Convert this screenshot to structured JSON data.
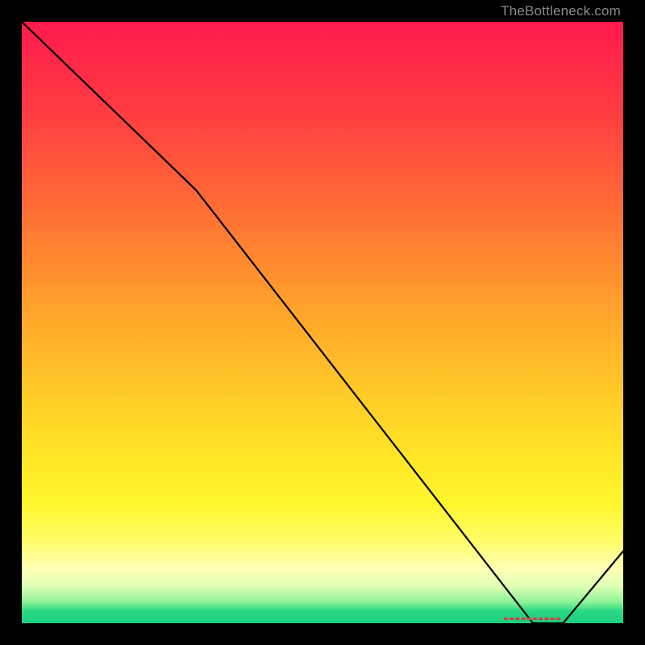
{
  "attribution": "TheBottleneck.com",
  "chart_data": {
    "type": "line",
    "x": [
      0,
      29,
      85,
      90,
      100
    ],
    "values": [
      100,
      72,
      0,
      0,
      12
    ],
    "title": "",
    "xlabel": "",
    "ylabel": "",
    "xlim": [
      0,
      100
    ],
    "ylim": [
      0,
      100
    ],
    "markers": {
      "shape": "dash-row",
      "x_start": 80.5,
      "x_end": 90,
      "y": 0
    }
  }
}
